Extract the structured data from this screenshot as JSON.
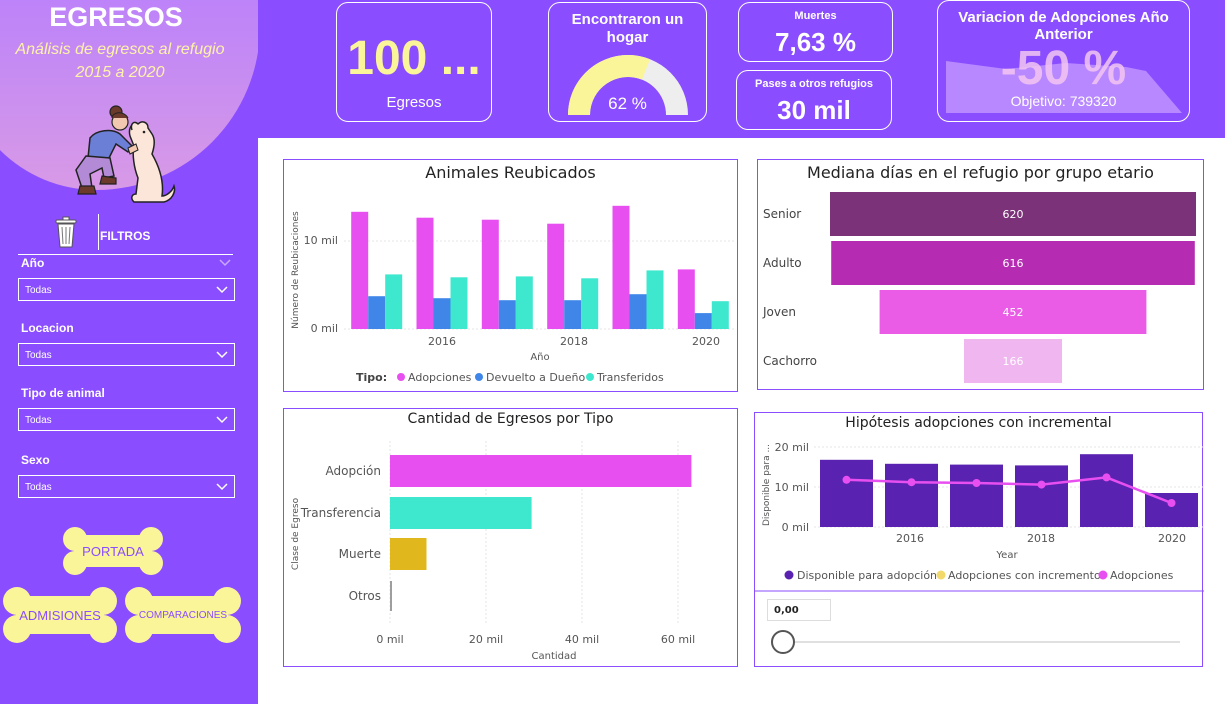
{
  "sidebar": {
    "title": "EGRESOS",
    "subtitle_line1": "Análisis de egresos al refugio",
    "subtitle_line2": "2015 a 2020",
    "filters_label": "FILTROS",
    "filters": [
      {
        "label": "Año",
        "value": "Todas"
      },
      {
        "label": "Locacion",
        "value": "Todas"
      },
      {
        "label": "Tipo de animal",
        "value": "Todas"
      },
      {
        "label": "Sexo",
        "value": "Todas"
      }
    ],
    "buttons": {
      "portada": "PORTADA",
      "admisiones": "ADMISIONES",
      "comparaciones": "COMPARACIONES"
    }
  },
  "kpis": {
    "egresos_value": "100 ...",
    "egresos_label": "Egresos",
    "hogar_title": "Encontraron un hogar",
    "hogar_value": "62 %",
    "hogar_fraction": 0.62,
    "muertes_label": "Muertes",
    "muertes_value": "7,63 %",
    "pases_label": "Pases a otros refugios",
    "pases_value": "30 mil",
    "variacion_title": "Variacion de Adopciones Año Anterior",
    "variacion_value": "-50 %",
    "variacion_goal": "Objetivo: 739320"
  },
  "colors": {
    "purple": "#8a4dff",
    "adopciones": "#e84ff0",
    "devuelto": "#3f86e8",
    "transferidos": "#3ee8cf",
    "muerte": "#e0b81e",
    "otros": "#9e9e9e",
    "disponible": "#5a22b0",
    "incremento": "#f2d96b"
  },
  "charts": {
    "reubicados": {
      "title": "Animales Reubicados",
      "ylabel": "Número de Reubicaciones",
      "xlabel": "Año",
      "ytick_labels": [
        "0 mil",
        "10 mil"
      ],
      "xtick_labels": [
        "2016",
        "2018",
        "2020"
      ],
      "legend_title": "Tipo:",
      "legend": [
        "Adopciones",
        "Devuelto a Dueño",
        "Transferidos"
      ]
    },
    "mediana": {
      "title": "Mediana días en el refugio por grupo etario"
    },
    "egresos_tipo": {
      "title": "Cantidad de Egresos por Tipo",
      "ylabel": "Clase de Egreso",
      "xlabel": "Cantidad",
      "xtick_labels": [
        "0 mil",
        "20 mil",
        "40 mil",
        "60 mil"
      ]
    },
    "hipotesis": {
      "title": "Hipótesis adopciones con incremental",
      "ylabel": "Disponible para ...",
      "xlabel": "Year",
      "ytick_labels": [
        "0 mil",
        "10 mil",
        "20 mil"
      ],
      "xtick_labels": [
        "2016",
        "2018",
        "2020"
      ],
      "legend": [
        "Disponible para adopción",
        "Adopciones con incremento",
        "Adopciones"
      ],
      "slider_value": "0,00",
      "slider_level": 0
    }
  },
  "chart_data": [
    {
      "type": "bar",
      "title": "Animales Reubicados",
      "xlabel": "Año",
      "ylabel": "Número de Reubicaciones",
      "categories": [
        "2015",
        "2016",
        "2017",
        "2018",
        "2019",
        "2020"
      ],
      "series": [
        {
          "name": "Adopciones",
          "values": [
            11800,
            11200,
            11000,
            10600,
            12400,
            6000
          ]
        },
        {
          "name": "Devuelto a Dueño",
          "values": [
            3300,
            3100,
            2900,
            2900,
            3500,
            1600
          ]
        },
        {
          "name": "Transferidos",
          "values": [
            5500,
            5200,
            5300,
            5100,
            5900,
            2800
          ]
        }
      ],
      "ylim": [
        0,
        15000
      ]
    },
    {
      "type": "bar",
      "title": "Mediana días en el refugio por grupo etario",
      "categories": [
        "Senior",
        "Adulto",
        "Joven",
        "Cachorro"
      ],
      "values": [
        620,
        616,
        452,
        166
      ],
      "data_labels": [
        "620",
        "616",
        "452",
        "166"
      ]
    },
    {
      "type": "bar",
      "title": "Cantidad de Egresos por Tipo",
      "xlabel": "Cantidad",
      "ylabel": "Clase de Egreso",
      "categories": [
        "Adopción",
        "Transferencia",
        "Muerte",
        "Otros"
      ],
      "values": [
        62800,
        29500,
        7600,
        300
      ],
      "xlim": [
        0,
        70000
      ]
    },
    {
      "type": "bar",
      "title": "Hipótesis adopciones con incremental",
      "xlabel": "Year",
      "ylabel": "Disponible para ...",
      "categories": [
        "2015",
        "2016",
        "2017",
        "2018",
        "2019",
        "2020"
      ],
      "series": [
        {
          "name": "Disponible para adopción",
          "values": [
            16800,
            15800,
            15600,
            15400,
            18200,
            8500
          ]
        },
        {
          "name": "Adopciones",
          "values": [
            11800,
            11200,
            11000,
            10600,
            12400,
            6000
          ]
        }
      ],
      "ylim": [
        0,
        22000
      ]
    }
  ]
}
